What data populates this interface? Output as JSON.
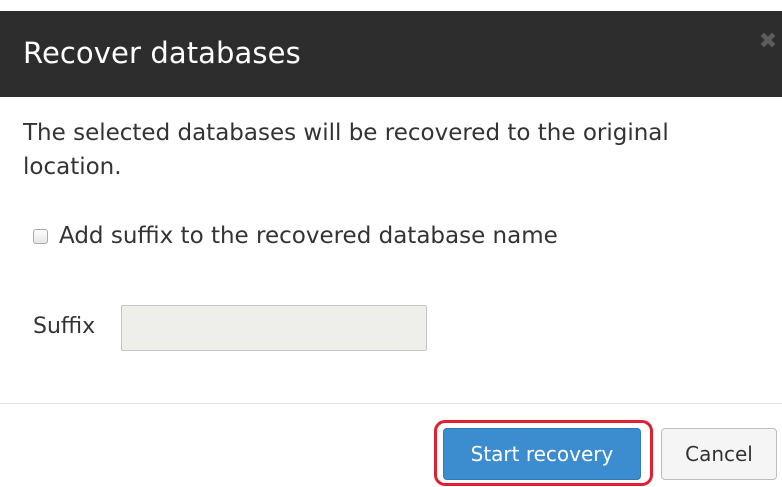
{
  "dialog": {
    "title": "Recover databases",
    "close_icon": "close-icon",
    "message": "The selected databases will be recovered to the original location.",
    "suffix_checkbox": {
      "label": "Add suffix to the recovered database name",
      "checked": false
    },
    "suffix_field": {
      "label": "Suffix",
      "value": ""
    },
    "buttons": {
      "start_label": "Start recovery",
      "cancel_label": "Cancel"
    }
  },
  "colors": {
    "header_background": "#2d2d2d",
    "primary_button": "#3c8dd0",
    "highlight_outline": "#e02030"
  }
}
